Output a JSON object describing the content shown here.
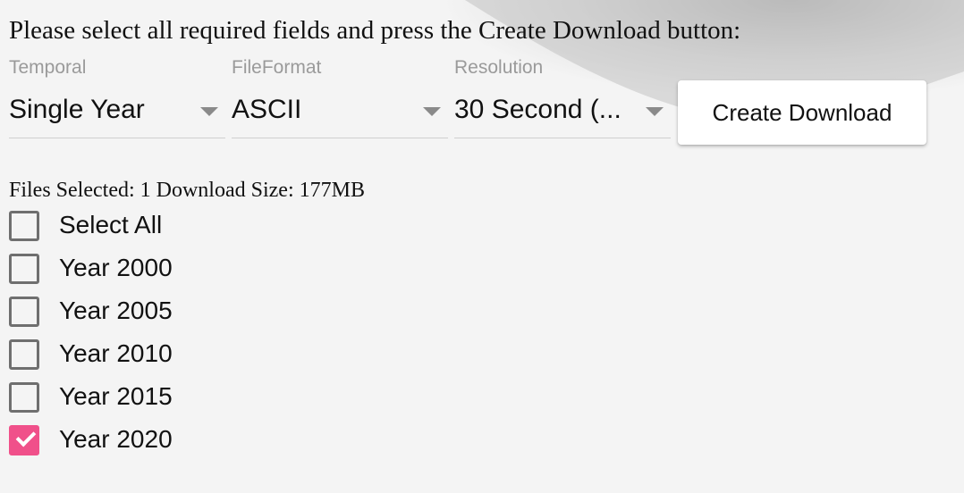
{
  "instructions": "Please select all required fields and press the Create Download button:",
  "fields": [
    {
      "label": "Temporal",
      "value": "Single Year"
    },
    {
      "label": "FileFormat",
      "value": "ASCII"
    },
    {
      "label": "Resolution",
      "value": "30 Second (..."
    }
  ],
  "create_button": "Create Download",
  "summary": {
    "files_selected": "Files Selected: 1",
    "download_size": "Download Size: 177MB"
  },
  "checklist": [
    {
      "label": "Select All",
      "checked": false
    },
    {
      "label": "Year 2000",
      "checked": false
    },
    {
      "label": "Year 2005",
      "checked": false
    },
    {
      "label": "Year 2010",
      "checked": false
    },
    {
      "label": "Year 2015",
      "checked": false
    },
    {
      "label": "Year 2020",
      "checked": true
    }
  ],
  "colors": {
    "accent": "#f0508a",
    "label_gray": "#9a9a9a",
    "background": "#f4f4f4"
  },
  "icons": {
    "dropdown": "triangle-down-icon",
    "check": "checkmark-icon"
  }
}
